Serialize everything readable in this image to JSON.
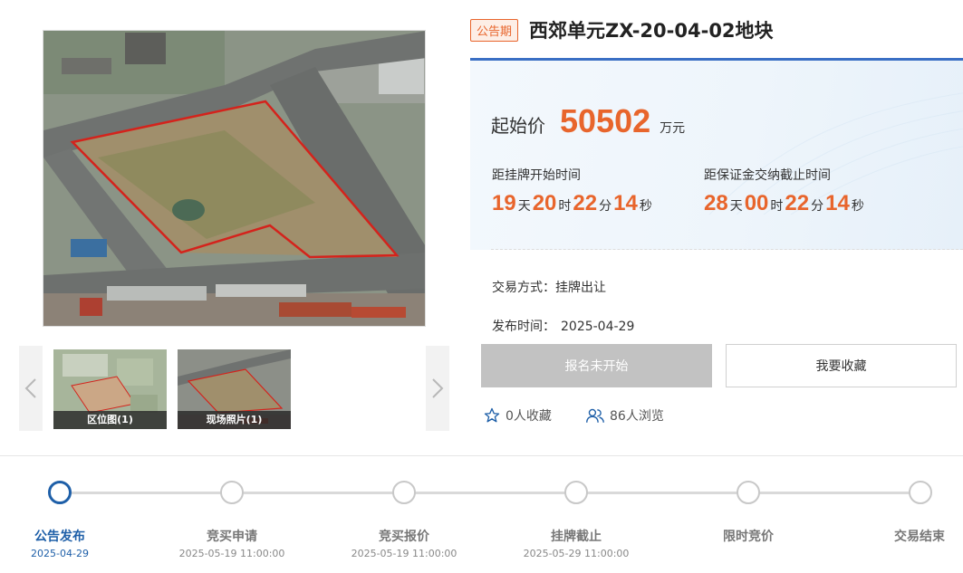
{
  "gallery": {
    "prev_icon": "chevron-left-icon",
    "next_icon": "chevron-right-icon",
    "thumbnails": [
      {
        "caption": "区位图(1)"
      },
      {
        "caption": "现场照片(1)"
      }
    ]
  },
  "lot": {
    "status_tag": "公告期",
    "title": "西郊单元ZX-20-04-02地块",
    "price_label": "起始价",
    "price_value": "50502",
    "price_unit": "万元"
  },
  "countdowns": [
    {
      "label": "距挂牌开始时间",
      "days": "19",
      "hours": "20",
      "minutes": "22",
      "seconds": "14"
    },
    {
      "label": "距保证金交纳截止时间",
      "days": "28",
      "hours": "00",
      "minutes": "22",
      "seconds": "14"
    }
  ],
  "units": {
    "day": "天",
    "hour": "时",
    "minute": "分",
    "second": "秒"
  },
  "info": {
    "trade_label": "交易方式：",
    "trade_value": "挂牌出让",
    "publish_label": "发布时间：",
    "publish_value": "2025-04-29"
  },
  "actions": {
    "signup_label": "报名未开始",
    "favorite_label": "我要收藏"
  },
  "stats": {
    "favorites": "0人收藏",
    "views": "86人浏览"
  },
  "colors": {
    "accent": "#e8652c",
    "brand": "#1e5fa8",
    "panel_border": "#3a6fc4"
  },
  "steps": [
    {
      "label": "公告发布",
      "date": "2025-04-29",
      "active": true
    },
    {
      "label": "竞买申请",
      "date": "2025-05-19 11:00:00",
      "active": false
    },
    {
      "label": "竞买报价",
      "date": "2025-05-19 11:00:00",
      "active": false
    },
    {
      "label": "挂牌截止",
      "date": "2025-05-29 11:00:00",
      "active": false
    },
    {
      "label": "限时竞价",
      "date": "",
      "active": false
    },
    {
      "label": "交易结束",
      "date": "",
      "active": false
    }
  ]
}
